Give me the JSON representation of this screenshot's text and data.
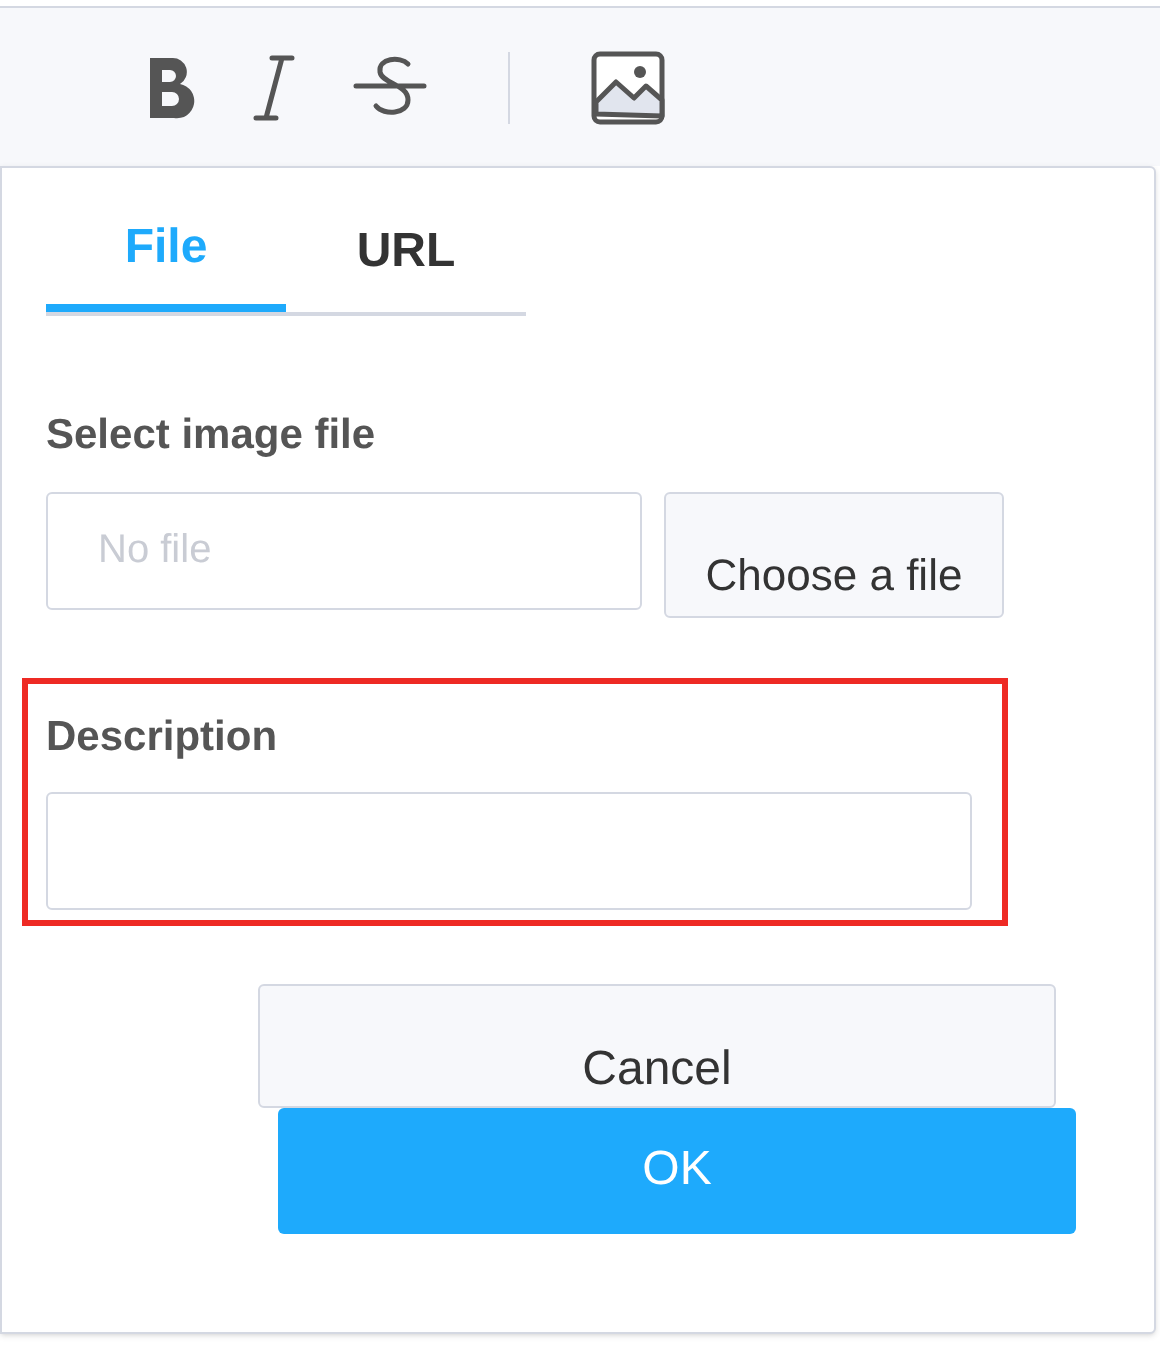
{
  "toolbar": {
    "buttons": [
      {
        "kind": "bold"
      },
      {
        "kind": "italic"
      },
      {
        "kind": "strike"
      },
      {
        "kind": "divider"
      },
      {
        "kind": "image"
      }
    ]
  },
  "popup": {
    "tabs": [
      {
        "label": "File",
        "selected": true
      },
      {
        "label": "URL",
        "selected": false
      }
    ],
    "file_field": {
      "label": "Select image file",
      "placeholder": "No file",
      "button": "Choose a file"
    },
    "description_field": {
      "label": "Description",
      "highlighted": true
    },
    "buttons": [
      {
        "label": "Cancel",
        "kind": "secondary"
      },
      {
        "label": "OK",
        "kind": "primary"
      }
    ]
  }
}
